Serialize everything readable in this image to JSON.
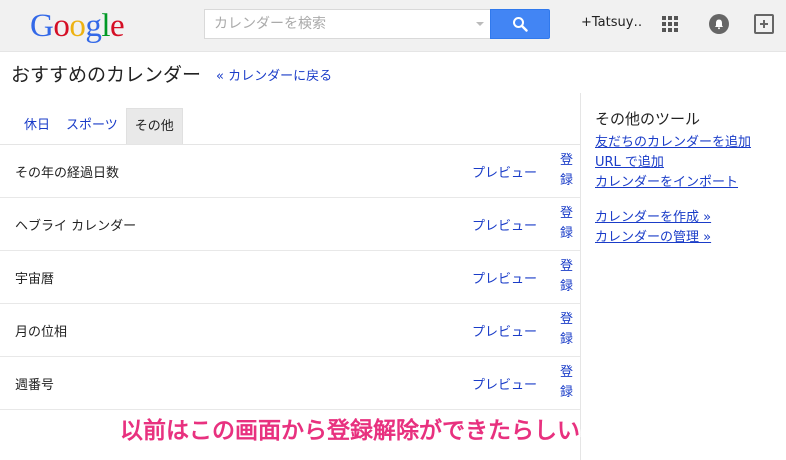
{
  "header": {
    "logo": [
      "G",
      "o",
      "o",
      "g",
      "l",
      "e"
    ],
    "logo_colors": [
      "#3369e8",
      "#d50f25",
      "#eeb211",
      "#3369e8",
      "#009925",
      "#d50f25"
    ],
    "search_placeholder": "カレンダーを検索",
    "user_label": "+Tatsuy…",
    "accent": "#4285f4"
  },
  "page": {
    "title": "おすすめのカレンダー",
    "back_link": "« カレンダーに戻る"
  },
  "tabs": [
    {
      "label": "休日",
      "active": false
    },
    {
      "label": "スポーツ",
      "active": false
    },
    {
      "label": "その他",
      "active": true
    }
  ],
  "calendars": [
    {
      "name": "その年の経過日数",
      "preview": "プレビュー",
      "register": "登録"
    },
    {
      "name": "ヘブライ カレンダー",
      "preview": "プレビュー",
      "register": "登録"
    },
    {
      "name": "宇宙暦",
      "preview": "プレビュー",
      "register": "登録"
    },
    {
      "name": "月の位相",
      "preview": "プレビュー",
      "register": "登録"
    },
    {
      "name": "週番号",
      "preview": "プレビュー",
      "register": "登録"
    }
  ],
  "tools": {
    "title": "その他のツール",
    "links": [
      "友だちのカレンダーを追加",
      "URL で追加",
      "カレンダーをインポート"
    ],
    "links2": [
      "カレンダーを作成 »",
      "カレンダーの管理 »"
    ]
  },
  "annotation": {
    "text": "以前はこの画面から登録解除ができたらしい",
    "color": "#e8317f"
  }
}
